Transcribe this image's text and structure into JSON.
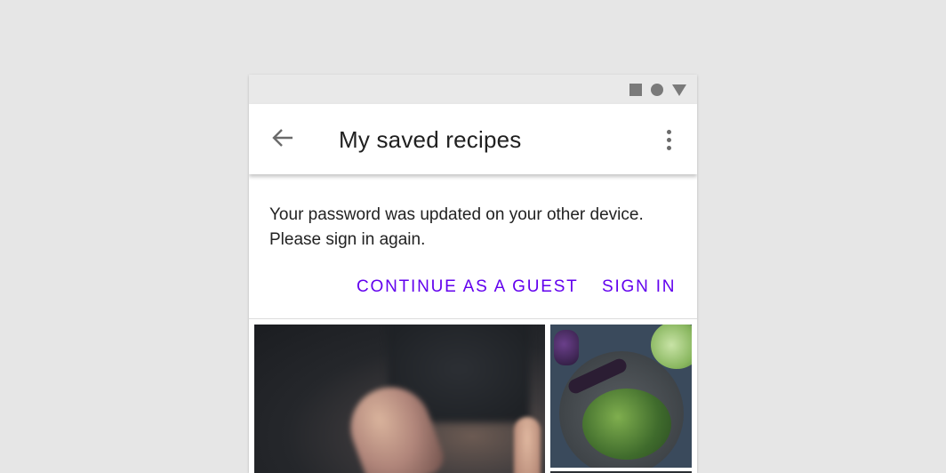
{
  "status_bar": {
    "icons": [
      "square-icon",
      "circle-icon",
      "triangle-icon"
    ]
  },
  "app_bar": {
    "title": "My saved recipes",
    "back_icon": "arrow-back-icon",
    "more_icon": "more-vert-icon"
  },
  "banner": {
    "message_line1": "Your password was updated on your other device.",
    "message_line2": "Please sign in again.",
    "continue_label": "CONTINUE AS A GUEST",
    "signin_label": "SIGN IN"
  },
  "images": [
    {
      "name": "recipe-image-cooking",
      "icon": "photo"
    },
    {
      "name": "recipe-image-vegetables",
      "icon": "photo"
    }
  ],
  "colors": {
    "accent": "#6200ee",
    "background": "#e6e6e6",
    "status_bar": "#e9e9e9"
  }
}
